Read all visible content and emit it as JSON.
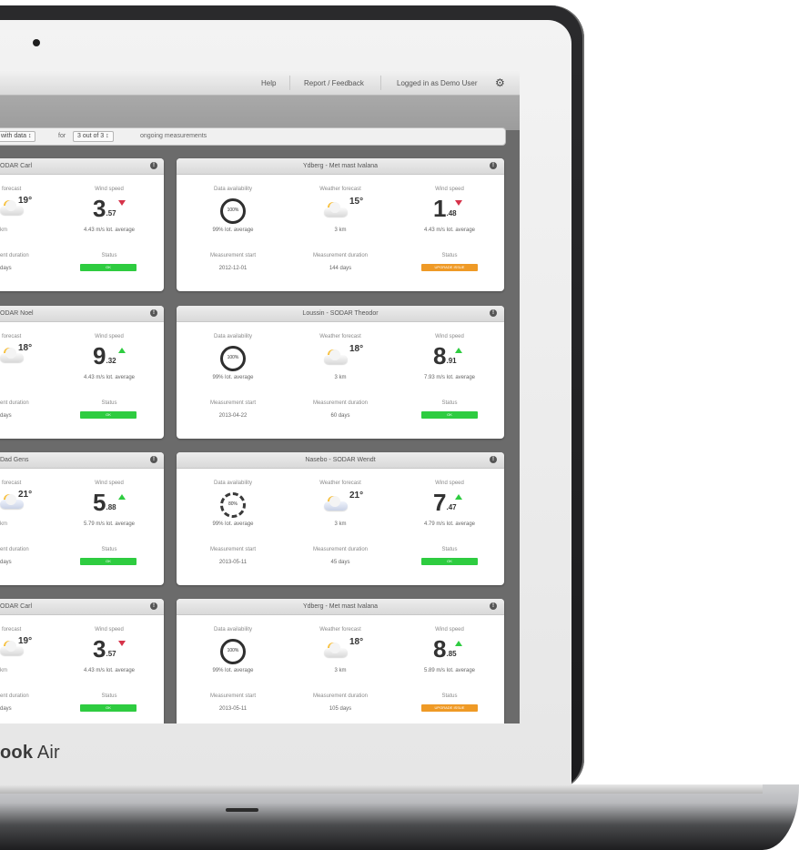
{
  "topbar": {
    "help": "Help",
    "feedback": "Report / Feedback",
    "logged_in": "Logged in as Demo User"
  },
  "filter": {
    "select_1": "with data ↕",
    "for_text": "for",
    "select_2": "3 out of 3 ↕",
    "suffix": "ongoing measurements"
  },
  "brand": {
    "bold": "ook",
    "light": " Air"
  },
  "left_cards": [
    {
      "title": "ODAR Carl",
      "weather_label": "forecast",
      "temp": "19°",
      "weather_sub": "km",
      "wind_label": "Wind speed",
      "wind_int": "3",
      "wind_dec": ".57",
      "wind_trend": "down",
      "wind_sub": "4.43 m/s lot. average",
      "duration_label": "ent duration",
      "duration_value": "days",
      "status_label": "Status",
      "status": "OK",
      "status_color": "green"
    },
    {
      "title": "ODAR Noel",
      "weather_label": "forecast",
      "temp": "18°",
      "weather_sub": "",
      "wind_label": "Wind speed",
      "wind_int": "9",
      "wind_dec": ".32",
      "wind_trend": "up",
      "wind_sub": "4.43 m/s lot. average",
      "duration_label": "ent duration",
      "duration_value": "days",
      "status_label": "Status",
      "status": "OK",
      "status_color": "green"
    },
    {
      "title": "Dad Gens",
      "weather_label": "forecast",
      "temp": "21°",
      "weather_sub": "km",
      "wind_label": "Wind speed",
      "wind_int": "5",
      "wind_dec": ".88",
      "wind_trend": "up",
      "wind_sub": "5.79 m/s lot. average",
      "duration_label": "ent duration",
      "duration_value": "days",
      "status_label": "Status",
      "status": "OK",
      "status_color": "green"
    },
    {
      "title": "ODAR Carl",
      "weather_label": "forecast",
      "temp": "19°",
      "weather_sub": "km",
      "wind_label": "Wind speed",
      "wind_int": "3",
      "wind_dec": ".57",
      "wind_trend": "down",
      "wind_sub": "4.43 m/s lot. average",
      "duration_label": "ent duration",
      "duration_value": "days",
      "status_label": "Status",
      "status": "OK",
      "status_color": "green"
    }
  ],
  "right_cards": [
    {
      "title": "Ydberg - Met mast Ivalana",
      "avail_label": "Data availability",
      "avail": "100%",
      "avail_sub": "99% lot. average",
      "weather_label": "Weather forecast",
      "temp": "15°",
      "weather_sub": "3 km",
      "wind_label": "Wind speed",
      "wind_int": "1",
      "wind_dec": ".48",
      "wind_trend": "down",
      "wind_sub": "4.43 m/s lot. average",
      "start_label": "Measurement start",
      "start_value": "2012-12-01",
      "duration_label": "Measurement duration",
      "duration_value": "144 days",
      "status_label": "Status",
      "status": "UPGRADE ISSUE",
      "status_color": "orange"
    },
    {
      "title": "Loussin - SODAR Theodor",
      "avail_label": "Data availability",
      "avail": "100%",
      "avail_sub": "99% lot. average",
      "weather_label": "Weather forecast",
      "temp": "18°",
      "weather_sub": "3 km",
      "wind_label": "Wind speed",
      "wind_int": "8",
      "wind_dec": ".91",
      "wind_trend": "up",
      "wind_sub": "7.93 m/s lot. average",
      "start_label": "Measurement start",
      "start_value": "2013-04-22",
      "duration_label": "Measurement duration",
      "duration_value": "60 days",
      "status_label": "Status",
      "status": "OK",
      "status_color": "green"
    },
    {
      "title": "Nasebo - SODAR Wendt",
      "avail_label": "Data availability",
      "avail": "80%",
      "avail_sub": "99% lot. average",
      "weather_label": "Weather forecast",
      "temp": "21°",
      "weather_sub": "3 km",
      "wind_label": "Wind speed",
      "wind_int": "7",
      "wind_dec": ".47",
      "wind_trend": "up",
      "wind_sub": "4.79 m/s lot. average",
      "start_label": "Measurement start",
      "start_value": "2013-05-11",
      "duration_label": "Measurement duration",
      "duration_value": "45 days",
      "status_label": "Status",
      "status": "OK",
      "status_color": "green"
    },
    {
      "title": "Ydberg - Met mast Ivalana",
      "avail_label": "Data availability",
      "avail": "100%",
      "avail_sub": "99% lot. average",
      "weather_label": "Weather forecast",
      "temp": "18°",
      "weather_sub": "3 km",
      "wind_label": "Wind speed",
      "wind_int": "8",
      "wind_dec": ".85",
      "wind_trend": "up",
      "wind_sub": "5.89 m/s lot. average",
      "start_label": "Measurement start",
      "start_value": "2013-05-11",
      "duration_label": "Measurement duration",
      "duration_value": "105 days",
      "status_label": "Status",
      "status": "UPGRADE ISSUE",
      "status_color": "orange"
    }
  ],
  "colors": {
    "ok": "#2ecc40",
    "warning": "#ef9a26",
    "trend_down": "#d6334a"
  }
}
